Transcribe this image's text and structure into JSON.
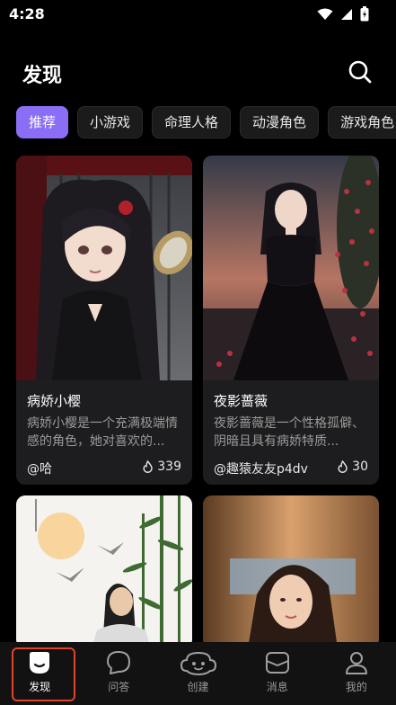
{
  "status_bar": {
    "time": "4:28",
    "icons": [
      "wifi-icon",
      "signal-icon",
      "battery-icon"
    ]
  },
  "header": {
    "title": "发现",
    "search_icon": "search-icon"
  },
  "tabs": [
    {
      "label": "推荐",
      "active": true
    },
    {
      "label": "小游戏",
      "active": false
    },
    {
      "label": "命理人格",
      "active": false
    },
    {
      "label": "动漫角色",
      "active": false
    },
    {
      "label": "游戏角色",
      "active": false
    }
  ],
  "cards": [
    {
      "title": "病娇小樱",
      "description": "病娇小樱是一个充满极端情感的角色，她对喜欢的...",
      "author": "@哈",
      "likes": "339"
    },
    {
      "title": "夜影蔷薇",
      "description": "夜影蔷薇是一个性格孤僻、阴暗且具有病娇特质...",
      "author": "@趣猿友友p4dv",
      "likes": "30"
    },
    {
      "title": "",
      "description": "",
      "author": "",
      "likes": ""
    },
    {
      "title": "",
      "description": "",
      "author": "",
      "likes": ""
    }
  ],
  "bottom_nav": [
    {
      "label": "发现",
      "icon": "discover-icon",
      "active": true
    },
    {
      "label": "问答",
      "icon": "chat-bubble-icon",
      "active": false
    },
    {
      "label": "创建",
      "icon": "create-icon",
      "active": false
    },
    {
      "label": "消息",
      "icon": "message-icon",
      "active": false
    },
    {
      "label": "我的",
      "icon": "profile-icon",
      "active": false
    }
  ],
  "colors": {
    "accent": "#8b6df6",
    "background": "#000000",
    "card": "#1d1d1f",
    "highlight": "#e0442a"
  }
}
